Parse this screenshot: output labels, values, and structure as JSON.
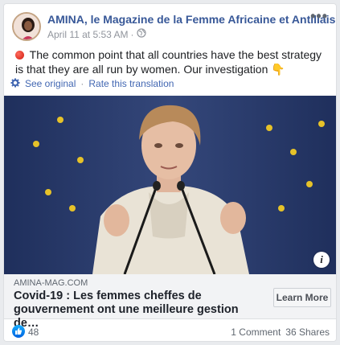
{
  "post": {
    "page_name": "AMINA, le Magazine de la Femme Africaine et Antillaise",
    "timestamp": "April 11 at 5:53 AM",
    "separator": "·",
    "audience_icon": "globe-icon",
    "more_icon": "ellipsis-icon",
    "text": "The common point that all countries have the best strategy is that they are all run by women. Our investigation",
    "text_emoji_start": "red-circle-icon",
    "text_emoji_end": "👇"
  },
  "translation": {
    "see_original": "See original",
    "separator": "·",
    "rate": "Rate this translation"
  },
  "link": {
    "domain": "AMINA-MAG.COM",
    "headline": "Covid-19 : Les femmes cheffes de gouvernement ont une meilleure gestion de…",
    "cta_label": "Learn More",
    "info_label": "i"
  },
  "stats": {
    "likes": "48",
    "comments": "1 Comment",
    "shares": "36 Shares"
  },
  "colors": {
    "link_blue": "#385898",
    "translation_blue": "#4267b2",
    "eu_flag_blue": "#2b3d6e",
    "like_blue": "#1877f2"
  }
}
